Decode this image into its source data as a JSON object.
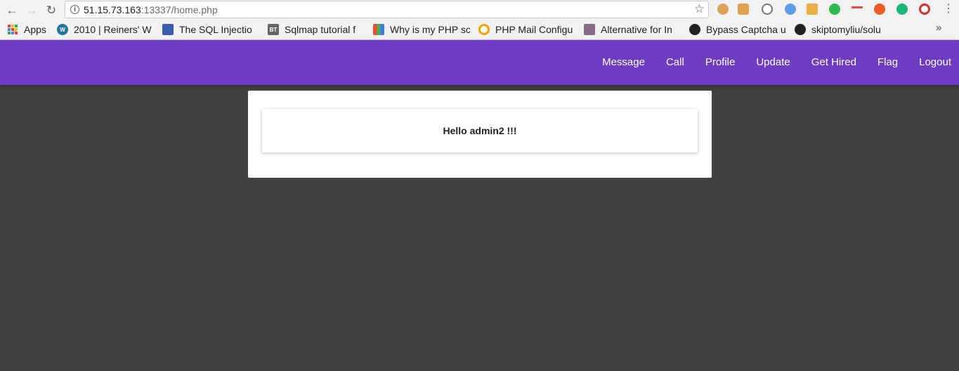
{
  "browser": {
    "url_host": "51.15.73.163",
    "url_rest": ":13337/home.php",
    "bookmarks": [
      {
        "label": "Apps",
        "icon": "apps-grid-icon"
      },
      {
        "label": "2010 | Reiners' W",
        "icon": "wordpress-icon"
      },
      {
        "label": "The SQL Injectio",
        "icon": "sql-injection-icon"
      },
      {
        "label": "Sqlmap tutorial f",
        "icon": "bt-icon",
        "badge": "BT"
      },
      {
        "label": "Why is my PHP sc",
        "icon": "colorful-grid-icon"
      },
      {
        "label": "PHP Mail Configu",
        "icon": "search-orange-icon"
      },
      {
        "label": "Alternative for In",
        "icon": "avatar-icon"
      },
      {
        "label": "Bypass Captcha u",
        "icon": "github-icon"
      },
      {
        "label": "skiptomyliu/solu",
        "icon": "github-icon"
      }
    ],
    "extensions": [
      "cookie-icon",
      "cookie-editor-icon",
      "wappalyzer-icon",
      "proxy-icon",
      "extension-icon",
      "hand-icon",
      "pattern-icon",
      "hackbar-icon",
      "grammarly-icon",
      "target-icon"
    ]
  },
  "nav": {
    "items": [
      "Message",
      "Call",
      "Profile",
      "Update",
      "Get Hired",
      "Flag",
      "Logout"
    ]
  },
  "main": {
    "greeting": "Hello admin2 !!!"
  },
  "colors": {
    "appbar": "#6d3cc3",
    "background": "#424242"
  }
}
